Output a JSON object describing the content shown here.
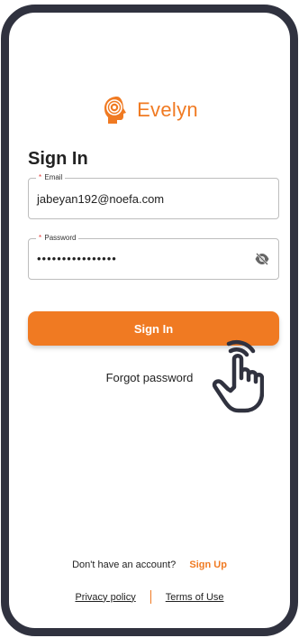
{
  "brand": {
    "name": "Evelyn",
    "accent_color": "#f07a22"
  },
  "form": {
    "title": "Sign In",
    "email": {
      "label": "Email",
      "required_marker": "*",
      "value": "jabeyan192@noefa.com"
    },
    "password": {
      "label": "Password",
      "required_marker": "*",
      "value": "••••••••••••••••",
      "visibility_icon": "eye-off-icon"
    },
    "submit_label": "Sign In",
    "forgot_label": "Forgot password"
  },
  "footer": {
    "no_account_text": "Don't have an account?",
    "signup_label": "Sign Up",
    "privacy_label": "Privacy policy",
    "terms_label": "Terms of Use"
  },
  "overlay": {
    "icon": "tap-hand-icon"
  }
}
